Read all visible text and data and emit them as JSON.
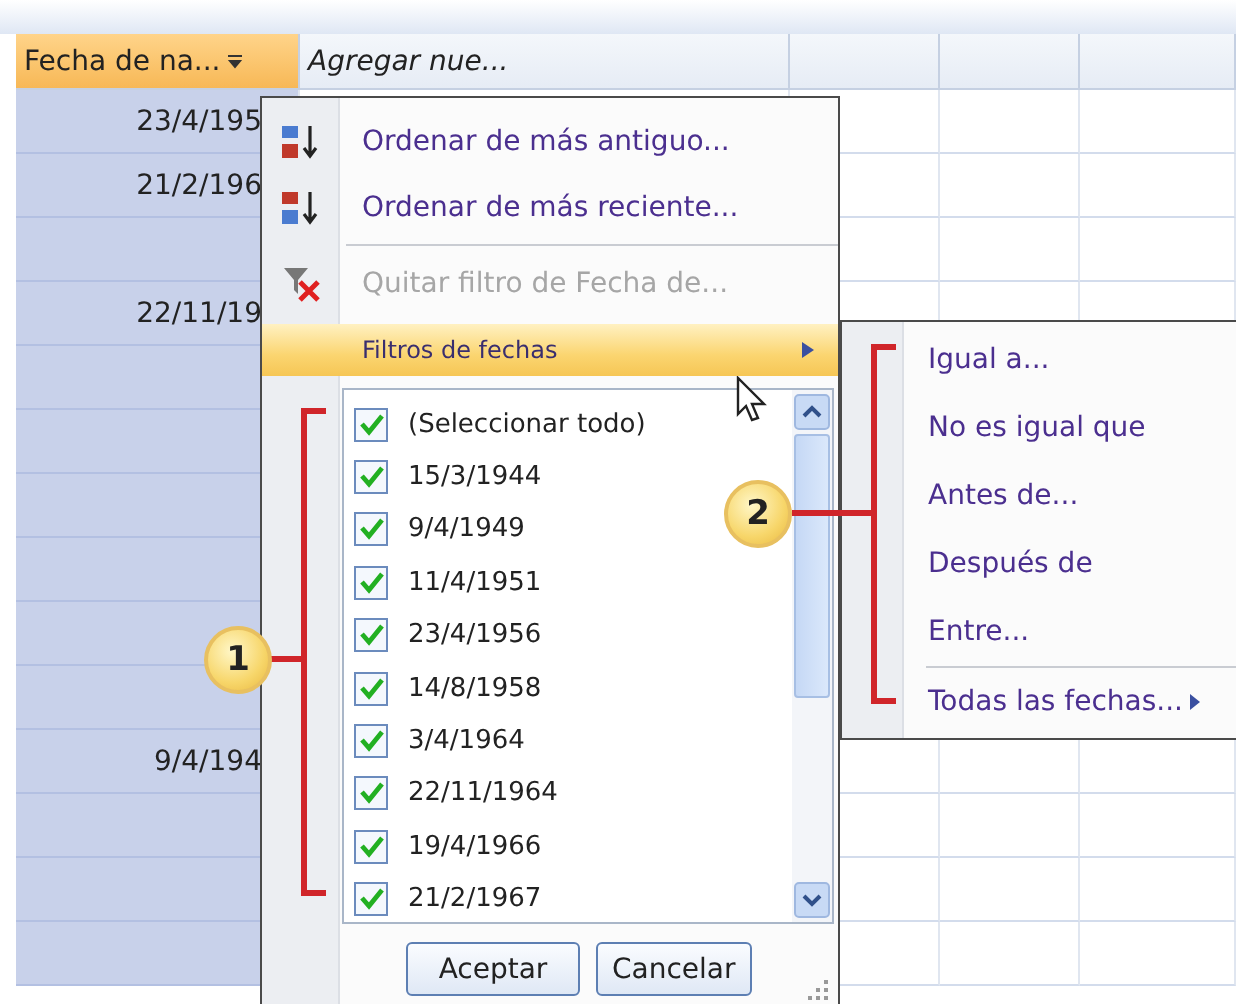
{
  "grid": {
    "columns": [
      {
        "label": "Fecha de na...",
        "selected": true
      },
      {
        "label": "Agregar nue...",
        "selected": false
      }
    ],
    "rows": [
      {
        "fecha": "23/4/195"
      },
      {
        "fecha": "21/2/196"
      },
      {},
      {
        "fecha": "22/11/19"
      },
      {},
      {},
      {},
      {},
      {},
      {},
      {
        "fecha": "9/4/194"
      },
      {},
      {},
      {}
    ]
  },
  "menu": {
    "items": [
      {
        "kind": "sort_asc",
        "label": "Ordenar de más antiguo...",
        "disabled": false
      },
      {
        "kind": "sort_desc",
        "label": "Ordenar de más reciente...",
        "disabled": false
      },
      {
        "kind": "clear_filter",
        "label": "Quitar filtro de Fecha de...",
        "disabled": true
      }
    ],
    "submenu_item": {
      "label": "Filtros de fechas",
      "selected": true
    },
    "checklist": [
      {
        "label": "(Seleccionar todo)",
        "checked": true
      },
      {
        "label": "15/3/1944",
        "checked": true
      },
      {
        "label": "9/4/1949",
        "checked": true
      },
      {
        "label": "11/4/1951",
        "checked": true
      },
      {
        "label": "23/4/1956",
        "checked": true
      },
      {
        "label": "14/8/1958",
        "checked": true
      },
      {
        "label": "3/4/1964",
        "checked": true
      },
      {
        "label": "22/11/1964",
        "checked": true
      },
      {
        "label": "19/4/1966",
        "checked": true
      },
      {
        "label": "21/2/1967",
        "checked": true
      }
    ],
    "buttons": [
      "Aceptar",
      "Cancelar"
    ]
  },
  "submenu": {
    "items": [
      {
        "label": "Igual a...",
        "has_submenu": false
      },
      {
        "label": "No es igual que",
        "has_submenu": false
      },
      {
        "label": "Antes de...",
        "has_submenu": false
      },
      {
        "label": "Después de",
        "has_submenu": false
      },
      {
        "label": "Entre...",
        "has_submenu": false
      },
      {
        "label": "Todas las fechas...",
        "has_submenu": true
      }
    ]
  },
  "callouts": [
    {
      "number": "1"
    },
    {
      "number": "2"
    }
  ]
}
